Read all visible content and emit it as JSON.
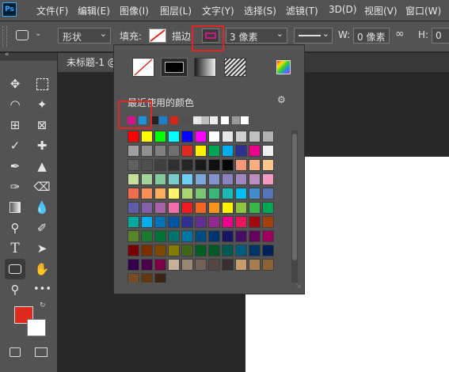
{
  "app": {
    "logo_text": "Ps"
  },
  "menu": {
    "items": [
      "文件(F)",
      "编辑(E)",
      "图像(I)",
      "图层(L)",
      "文字(Y)",
      "选择(S)",
      "滤镜(T)",
      "3D(D)",
      "视图(V)",
      "窗口(W)"
    ]
  },
  "options": {
    "mode_value": "形状",
    "fill_label": "填充:",
    "stroke_label": "描边:",
    "stroke_width": "3 像素",
    "w_label": "W:",
    "w_value": "0 像素",
    "h_label": "H:",
    "h_value": "0"
  },
  "document": {
    "tab_title": "未标题-1 @"
  },
  "popup": {
    "recent_label": "最近使用的颜色"
  },
  "colors": {
    "foreground": "#e02a1f",
    "background": "#ffffff",
    "highlight": "#e52525",
    "stroke_swatch": "#d6148a"
  },
  "swatches": {
    "recent": [
      "#d6148a",
      "#1e90d8",
      "#242424",
      "#1e7fd0",
      "#d6241b",
      "#505050",
      "#e8e8e8",
      "#bfbfbf",
      "#eeeeee",
      "#ffffff",
      "#999999",
      "#ffffff"
    ],
    "grid": [
      [
        "#ff0000",
        "#ffff00",
        "#00ff00",
        "#00ffff",
        "#0000ff",
        "#ff00ff",
        "#ffffff",
        "#e8e8e8",
        "#d0d0d0",
        "#c0c0c0",
        "#b0b0b0"
      ],
      [
        "#a0a0a0",
        "#909090",
        "#808080",
        "#707070",
        "#e02a1f",
        "#fff200",
        "#00a651",
        "#00aeef",
        "#2e3192",
        "#ec008c",
        "#f0f0f0"
      ],
      [
        "#606060",
        "#505050",
        "#404040",
        "#303030",
        "#262626",
        "#1a1a1a",
        "#101010",
        "#080808",
        "#f7977a",
        "#fbad82",
        "#fdc68c"
      ],
      [
        "#c4df9b",
        "#a3d39c",
        "#82ca9c",
        "#7accc8",
        "#6dcff6",
        "#7da7d9",
        "#8493ca",
        "#8882be",
        "#a187be",
        "#bc8dbf",
        "#f49ac2"
      ],
      [
        "#f26c4f",
        "#f68e56",
        "#fbaf5c",
        "#fff467",
        "#acd372",
        "#7cc576",
        "#3bb878",
        "#1abbb4",
        "#00bff3",
        "#438ccb",
        "#5574b9"
      ],
      [
        "#605ca8",
        "#855fa8",
        "#a763a8",
        "#f06ea9",
        "#ed1c24",
        "#f26522",
        "#f7941d",
        "#fff200",
        "#8dc63f",
        "#39b54a",
        "#00a651"
      ],
      [
        "#00a99d",
        "#00aeef",
        "#0072bc",
        "#0054a6",
        "#2e3192",
        "#662d91",
        "#92278f",
        "#ec008c",
        "#ed145b",
        "#9e0b0f",
        "#a0410d"
      ],
      [
        "#598527",
        "#197b30",
        "#007236",
        "#00746b",
        "#0076a3",
        "#004b80",
        "#003471",
        "#1b1464",
        "#440e62",
        "#630460",
        "#9e005d"
      ],
      [
        "#790000",
        "#7b2e00",
        "#7d4900",
        "#827b00",
        "#406618",
        "#005e20",
        "#005826",
        "#005952",
        "#005b7f",
        "#003663",
        "#002157"
      ],
      [
        "#32004b",
        "#4b0049",
        "#7b0046",
        "#c7b299",
        "#998675",
        "#736357",
        "#534741",
        "#362f2d",
        "#c69c6d",
        "#a67c52",
        "#8c6239"
      ],
      [
        "#754c24",
        "#603913",
        "#3c2415"
      ]
    ]
  }
}
